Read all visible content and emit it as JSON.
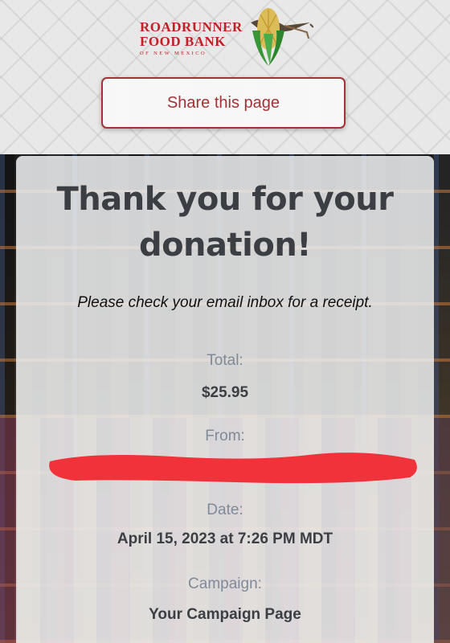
{
  "header": {
    "logo": {
      "line1": "ROADRUNNER",
      "line2": "FOOD BANK",
      "sub": "OF NEW MEXICO",
      "icon": "corn-roadrunner-logo"
    },
    "share_label": "Share this page"
  },
  "card": {
    "title": "Thank you for your donation!",
    "subtitle": "Please check your email inbox for a receipt.",
    "total_label": "Total:",
    "total_value": "$25.95",
    "from_label": "From:",
    "date_label": "Date:",
    "date_value": "April 15, 2023 at 7:26 PM MDT",
    "campaign_label": "Campaign:",
    "campaign_value": "Your Campaign Page"
  },
  "colors": {
    "brand_red": "#c8202a",
    "button_border": "#a83236",
    "label_gray": "#7f8a99",
    "text_dark": "#3b3f44",
    "redaction": "#f0323a"
  }
}
